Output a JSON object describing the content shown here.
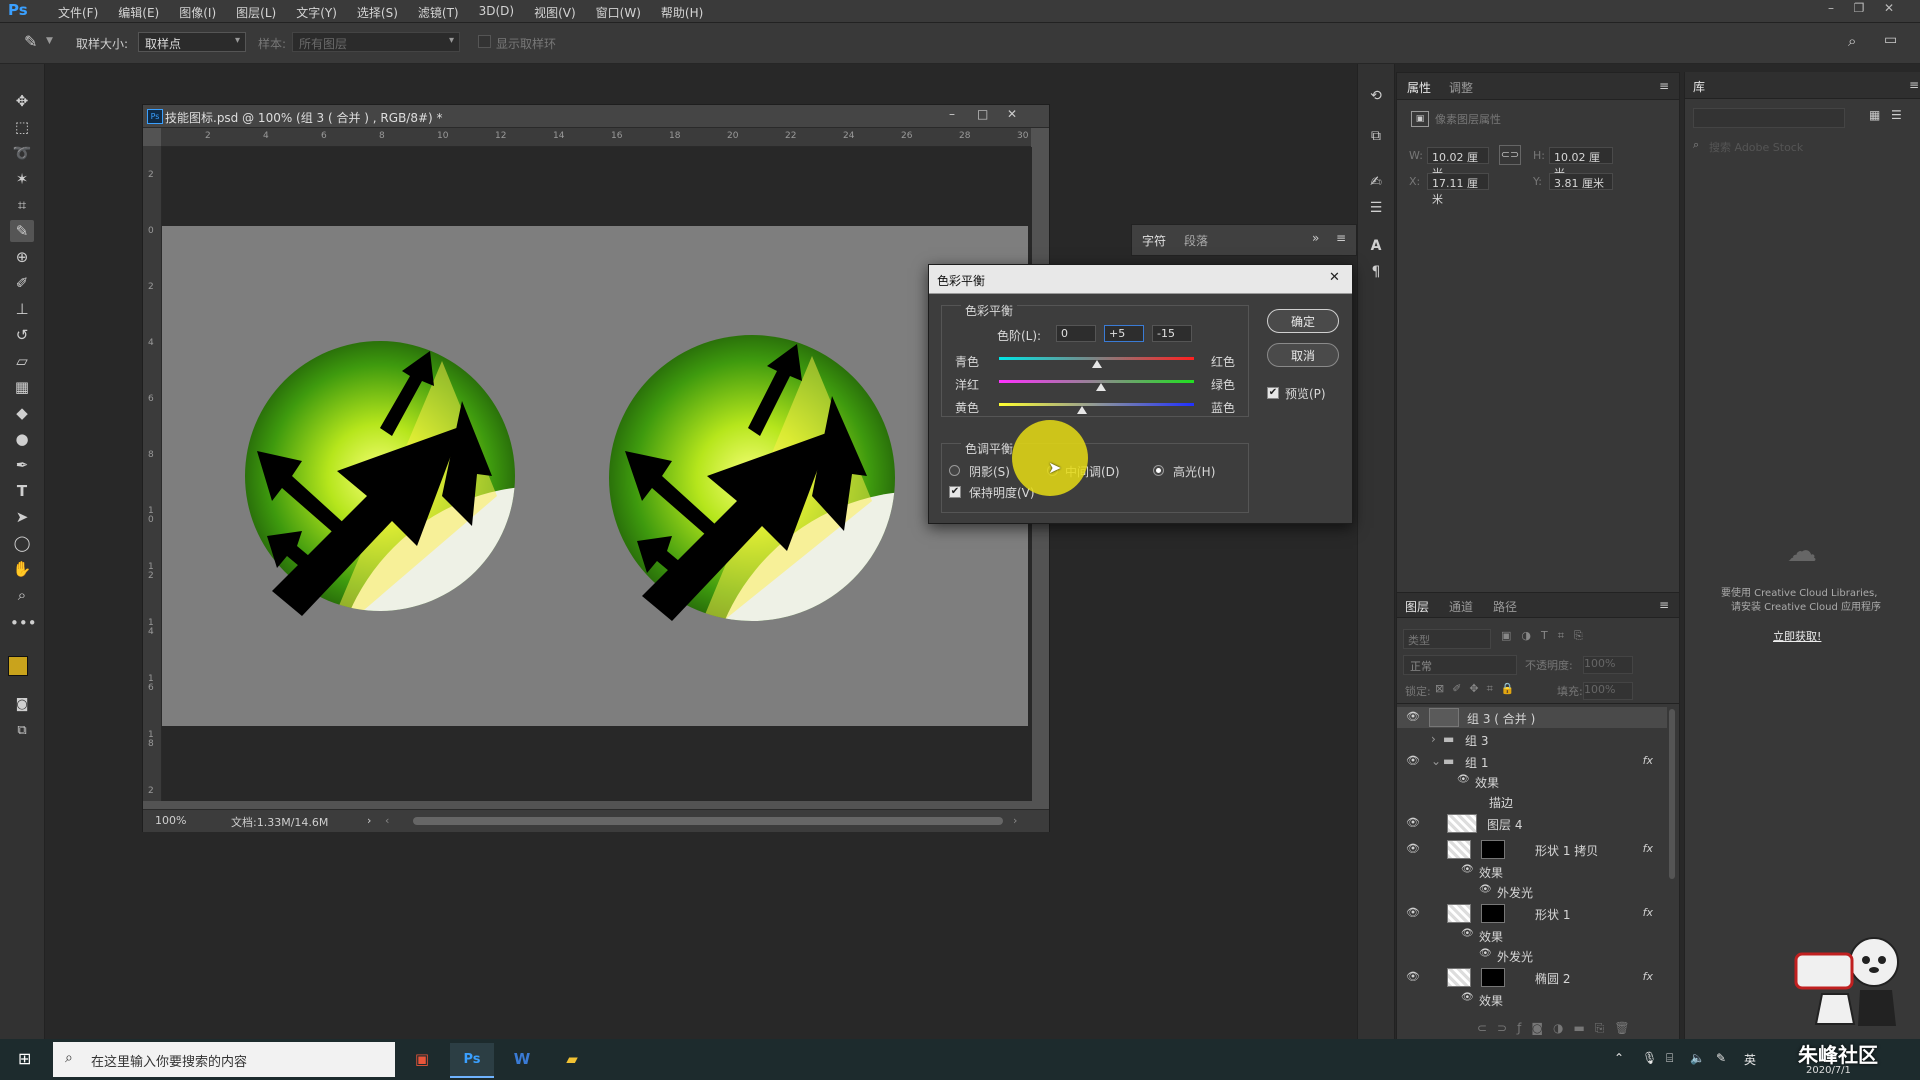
{
  "menubar": {
    "logo": "Ps",
    "items": [
      "文件(F)",
      "编辑(E)",
      "图像(I)",
      "图层(L)",
      "文字(Y)",
      "选择(S)",
      "滤镜(T)",
      "3D(D)",
      "视图(V)",
      "窗口(W)",
      "帮助(H)"
    ]
  },
  "options": {
    "sample_size_label": "取样大小:",
    "sample_size_value": "取样点",
    "sample_label": "样本:",
    "sample_value": "所有图层",
    "show_ring": "显示取样环"
  },
  "document": {
    "title": "技能图标.psd @ 100% (组 3 ( 合并 ) , RGB/8#) *",
    "zoom": "100%",
    "doc_info": "文档:1.33M/14.6M",
    "hruler": [
      "2",
      "4",
      "6",
      "8",
      "10",
      "12",
      "14",
      "16",
      "18",
      "20",
      "22",
      "24",
      "26",
      "28",
      "30"
    ],
    "vruler": [
      "2",
      "0",
      "2",
      "4",
      "6",
      "8",
      "1\n0",
      "1\n2",
      "1\n4",
      "1\n6",
      "1\n8",
      "2"
    ]
  },
  "properties": {
    "tab1": "属性",
    "tab2": "调整",
    "subtitle": "像素图层属性",
    "w_label": "W:",
    "w_value": "10.02 厘米",
    "h_label": "H:",
    "h_value": "10.02 厘米",
    "x_label": "X:",
    "x_value": "17.11 厘米",
    "y_label": "Y:",
    "y_value": "3.81 厘米"
  },
  "library": {
    "title": "库",
    "search_placeholder": "搜索 Adobe Stock",
    "cc_msg_line1": "要使用 Creative Cloud Libraries,",
    "cc_msg_line2": "请安装 Creative Cloud 应用程序",
    "get_now": "立即获取!"
  },
  "charpanel": {
    "tab1": "字符",
    "tab2": "段落"
  },
  "dialog": {
    "title": "色彩平衡",
    "group1": "色彩平衡",
    "levels_label": "色阶(L):",
    "levels": [
      "0",
      "+5",
      "-15"
    ],
    "cyan": "青色",
    "red": "红色",
    "magenta": "洋红",
    "green": "绿色",
    "yellow": "黄色",
    "blue": "蓝色",
    "slider_values": [
      0,
      5,
      -15
    ],
    "group2": "色调平衡",
    "shadows": "阴影(S)",
    "midtones": "中间调(D)",
    "highlights": "高光(H)",
    "preserve": "保持明度(V)",
    "ok": "确定",
    "cancel": "取消",
    "preview": "预览(P)"
  },
  "layers": {
    "tabs": [
      "图层",
      "通道",
      "路径"
    ],
    "filter_placeholder": "类型",
    "blend_mode": "正常",
    "opacity_label": "不透明度:",
    "opacity_value": "100%",
    "lock_label": "锁定:",
    "fill_label": "填充:",
    "fill_value": "100%",
    "rows": [
      {
        "name": "组 3 ( 合并 )",
        "kind": "layer"
      },
      {
        "name": "组 3",
        "kind": "group"
      },
      {
        "name": "组 1",
        "kind": "group",
        "fx": "fx"
      },
      {
        "name": "效果",
        "kind": "sub"
      },
      {
        "name": "描边",
        "kind": "sub2"
      },
      {
        "name": "图层 4",
        "kind": "layer"
      },
      {
        "name": "形状 1 拷贝",
        "kind": "shape",
        "fx": "fx"
      },
      {
        "name": "效果",
        "kind": "sub"
      },
      {
        "name": "外发光",
        "kind": "sub2"
      },
      {
        "name": "形状 1",
        "kind": "shape",
        "fx": "fx"
      },
      {
        "name": "效果",
        "kind": "sub"
      },
      {
        "name": "外发光",
        "kind": "sub2"
      },
      {
        "name": "椭圆 2",
        "kind": "shape",
        "fx": "fx"
      },
      {
        "name": "效果",
        "kind": "sub"
      }
    ]
  },
  "taskbar": {
    "search_placeholder": "在这里输入你要搜索的内容",
    "ime": "英",
    "watermark": "朱峰社区",
    "date": "2020/7/1"
  }
}
